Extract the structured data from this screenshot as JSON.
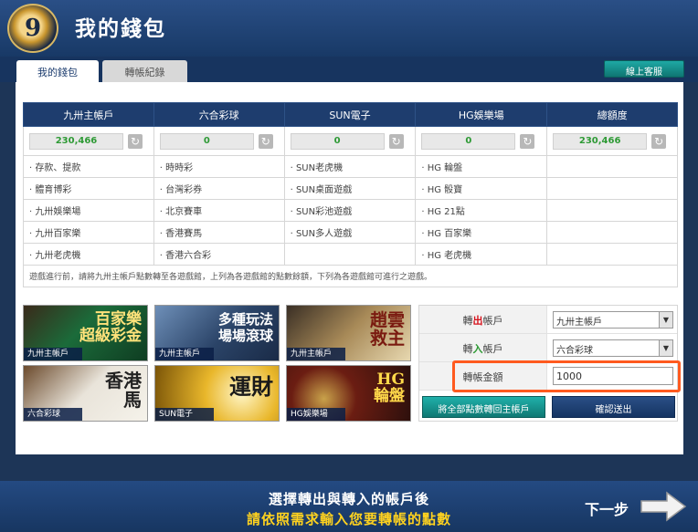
{
  "header": {
    "logo_glyph": "9",
    "title": "我的錢包"
  },
  "tabs": {
    "wallet": "我的錢包",
    "records": "轉帳紀錄"
  },
  "customer_service": "線上客服",
  "accounts": [
    {
      "name": "九卅主帳戶",
      "balance": "230,466",
      "items": [
        "‧ 存款、提款",
        "‧ 體育博彩",
        "‧ 九卅娛樂場",
        "‧ 九卅百家樂",
        "‧ 九卅老虎機"
      ]
    },
    {
      "name": "六合彩球",
      "balance": "0",
      "items": [
        "‧ 時時彩",
        "‧ 台灣彩券",
        "‧ 北京賽車",
        "‧ 香港賽馬",
        "‧ 香港六合彩"
      ]
    },
    {
      "name": "SUN電子",
      "balance": "0",
      "items": [
        "‧ SUN老虎機",
        "‧ SUN桌面遊戲",
        "‧ SUN彩池遊戲",
        "‧ SUN多人遊戲",
        ""
      ]
    },
    {
      "name": "HG娛樂場",
      "balance": "0",
      "items": [
        "‧ HG 輪盤",
        "‧ HG 骰寶",
        "‧ HG 21點",
        "‧ HG 百家樂",
        "‧ HG 老虎機"
      ]
    },
    {
      "name": "總額度",
      "balance": "230,466",
      "items": [
        "",
        "",
        "",
        "",
        ""
      ]
    }
  ],
  "refresh_glyph": "↻",
  "note": "遊戲進行前，請將九卅主帳戶點數轉至各遊戲館，上列為各遊戲館的點數餘額，下列為各遊戲館可進行之遊戲。",
  "banners": [
    {
      "title1": "百家樂",
      "title2": "超級彩金",
      "caption": "九卅主帳戶"
    },
    {
      "title1": "多種玩法",
      "title2": "場場滾球",
      "caption": "九卅主帳戶"
    },
    {
      "title1": "趙雲",
      "title2": "救主",
      "caption": "九卅主帳戶"
    },
    {
      "title1": "香港",
      "title2": "馬",
      "caption": "六合彩球"
    },
    {
      "title1": "",
      "title2": "運財",
      "caption": "SUN電子"
    },
    {
      "title1": "HG",
      "title2": "輪盤",
      "caption": "HG娛樂場"
    }
  ],
  "form": {
    "out_label_pre": "轉",
    "out_label_hl": "出",
    "out_label_post": "帳戶",
    "out_value": "九卅主帳戶",
    "in_label_pre": "轉",
    "in_label_hl": "入",
    "in_label_post": "帳戶",
    "in_value": "六合彩球",
    "amount_label": "轉帳金額",
    "amount_value": "1000",
    "transfer_all": "將全部點數轉回主帳戶",
    "confirm": "確認送出",
    "arrow": "▼"
  },
  "footer": {
    "line1": "選擇轉出與轉入的帳戶後",
    "line2": "請依照需求輸入您要轉帳的點數",
    "next": "下一步"
  },
  "colors": {
    "header": "#1e3d6e",
    "accent_red": "#d6101a",
    "accent_green": "#2e9a35",
    "highlight_box": "#ff5a1f",
    "footer_yellow": "#ffd21f"
  }
}
